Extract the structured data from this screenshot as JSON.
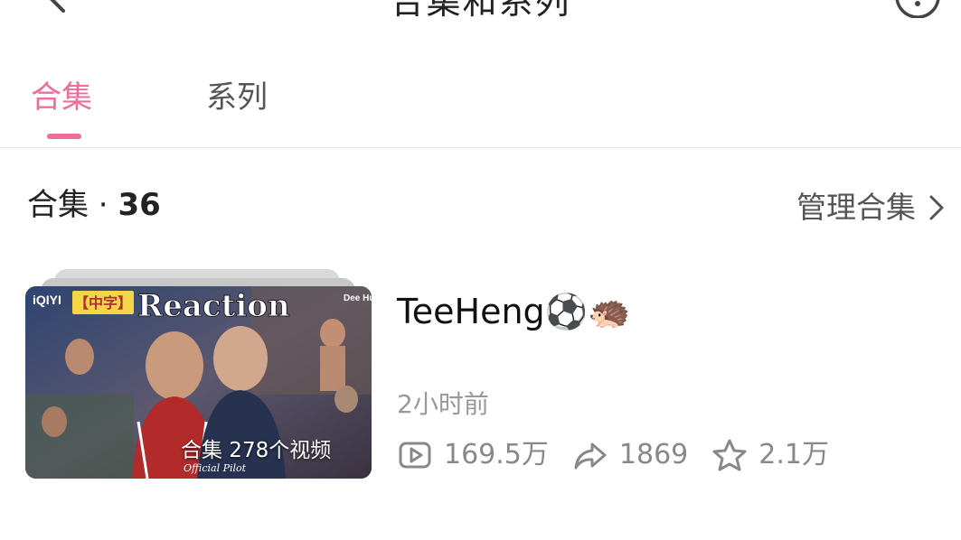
{
  "header": {
    "title": "合集和系列"
  },
  "tabs": [
    {
      "label": "合集",
      "active": true
    },
    {
      "label": "系列",
      "active": false
    }
  ],
  "section": {
    "label": "合集",
    "separator": " · ",
    "count": "36",
    "manage_label": "管理合集"
  },
  "item": {
    "title": "TeeHeng⚽🦔",
    "time": "2小时前",
    "thumbnail_caption": "合集 278个视频",
    "thumbnail_texts": {
      "brand": "iQIYI",
      "badge": "【中字】",
      "headline": "Reaction",
      "corner": "Dee Hup",
      "sub": "Official Pilot"
    },
    "stats": {
      "plays": "169.5万",
      "shares": "1869",
      "favorites": "2.1万"
    }
  },
  "colors": {
    "accent": "#ee6d9b",
    "text": "#222222",
    "muted": "#888888"
  }
}
